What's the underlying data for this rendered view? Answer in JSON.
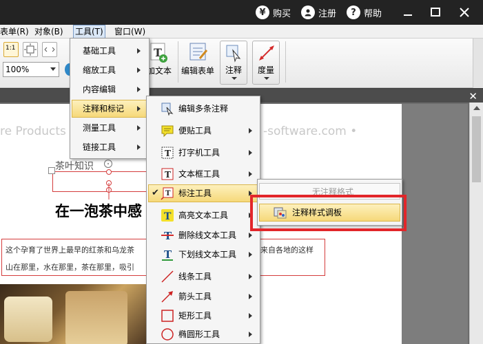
{
  "titlebar": {
    "buy": {
      "icon": "¥",
      "label": "购买"
    },
    "register": {
      "icon": "person-icon",
      "label": "注册"
    },
    "help": {
      "icon": "?",
      "label": "帮助"
    }
  },
  "menubar": {
    "items": [
      "表单(R)",
      "对象(B)",
      "工具(T)",
      "窗口(W)"
    ],
    "active": "工具(T)"
  },
  "ribbon": {
    "zoom": "100%",
    "add_text": "加文本",
    "edit_form": "编辑表单",
    "annotate": "注释",
    "measure": "度量",
    "actual_size_icon": "1:1"
  },
  "tools_menu": {
    "items": [
      {
        "label": "基础工具",
        "submenu": true
      },
      {
        "label": "缩放工具",
        "submenu": true
      },
      {
        "label": "内容编辑",
        "submenu": true
      },
      {
        "label": "注释和标记",
        "submenu": true,
        "highlighted": true
      },
      {
        "label": "测量工具",
        "submenu": true
      },
      {
        "label": "链接工具",
        "submenu": true
      }
    ]
  },
  "annot_menu": {
    "items": [
      {
        "label": "编辑多条注释",
        "icon": "edit-annotations-icon",
        "submenu": false
      },
      {
        "label": "便贴工具",
        "icon": "sticky-note-icon",
        "submenu": true
      },
      {
        "label": "打字机工具",
        "icon": "typewriter-icon",
        "submenu": true
      },
      {
        "label": "文本框工具",
        "icon": "textbox-icon",
        "submenu": true
      },
      {
        "label": "标注工具",
        "icon": "callout-icon",
        "submenu": true,
        "checked": true,
        "highlighted": true
      },
      {
        "label": "高亮文本工具",
        "icon": "highlight-text-icon",
        "submenu": true
      },
      {
        "label": "删除线文本工具",
        "icon": "strikeout-icon",
        "submenu": true
      },
      {
        "label": "下划线文本工具",
        "icon": "underline-icon",
        "submenu": true
      },
      {
        "label": "线条工具",
        "icon": "line-icon",
        "submenu": true
      },
      {
        "label": "箭头工具",
        "icon": "arrow-icon",
        "submenu": true
      },
      {
        "label": "矩形工具",
        "icon": "rectangle-icon",
        "submenu": true
      },
      {
        "label": "椭圆形工具",
        "icon": "ellipse-icon",
        "submenu": true
      }
    ]
  },
  "callout_menu": {
    "items": [
      {
        "label": "无注释格式",
        "disabled": true
      },
      {
        "label": "注释样式调板",
        "icon": "style-palette-icon",
        "highlighted": true
      }
    ]
  },
  "document": {
    "watermark_left": "re Products",
    "watermark_right": "-software.com •",
    "tea_label": "茶叶知识",
    "heading": "在一泡茶中感",
    "para_line1": "这个孕育了世界上最早的红茶和乌龙茶",
    "para_line1_tail": "来自各地的这样",
    "para_line2": "山在那里，水在那里，茶在那里，吸引"
  },
  "colors": {
    "titlebar": "#232323",
    "highlight": "#f6d97a",
    "annotation_red": "#e2262a"
  }
}
